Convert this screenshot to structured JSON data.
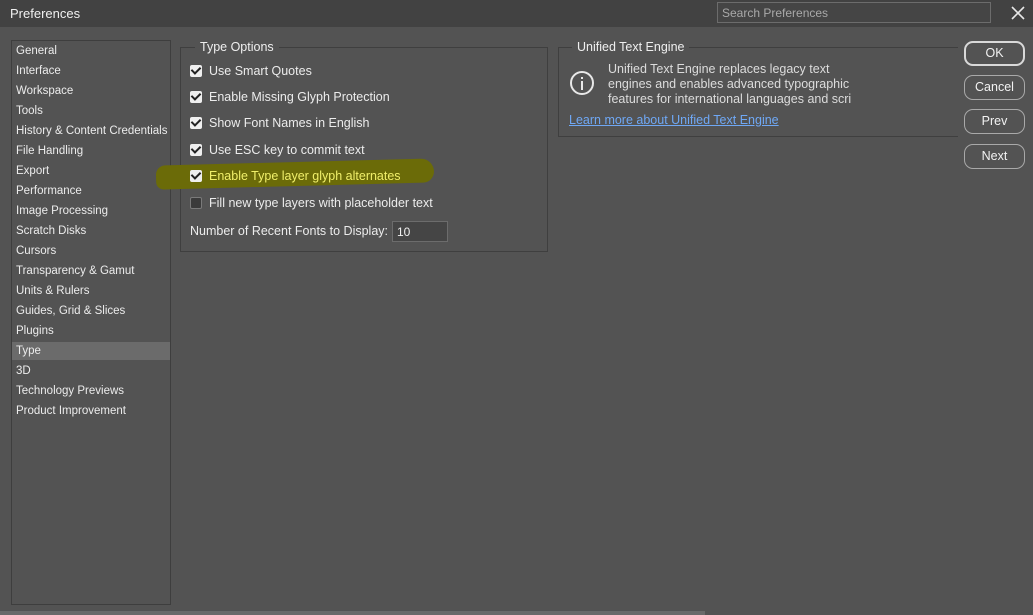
{
  "window": {
    "title": "Preferences",
    "search_placeholder": "Search Preferences"
  },
  "sidebar": {
    "items": [
      {
        "label": "General"
      },
      {
        "label": "Interface"
      },
      {
        "label": "Workspace"
      },
      {
        "label": "Tools"
      },
      {
        "label": "History & Content Credentials"
      },
      {
        "label": "File Handling"
      },
      {
        "label": "Export"
      },
      {
        "label": "Performance"
      },
      {
        "label": "Image Processing"
      },
      {
        "label": "Scratch Disks"
      },
      {
        "label": "Cursors"
      },
      {
        "label": "Transparency & Gamut"
      },
      {
        "label": "Units & Rulers"
      },
      {
        "label": "Guides, Grid & Slices"
      },
      {
        "label": "Plugins"
      },
      {
        "label": "Type"
      },
      {
        "label": "3D"
      },
      {
        "label": "Technology Previews"
      },
      {
        "label": "Product Improvement"
      }
    ],
    "selected": "Type"
  },
  "type_options": {
    "title": "Type Options",
    "options": [
      {
        "label": "Use Smart Quotes",
        "checked": true
      },
      {
        "label": "Enable Missing Glyph Protection",
        "checked": true
      },
      {
        "label": "Show Font Names in English",
        "checked": true
      },
      {
        "label": "Use ESC key to commit text",
        "checked": true
      },
      {
        "label": "Enable Type layer glyph alternates",
        "checked": true
      },
      {
        "label": "Fill new type layers with placeholder text",
        "checked": false
      }
    ],
    "recent_fonts_label": "Number of Recent Fonts to Display:",
    "recent_fonts_value": "10"
  },
  "unified_text_engine": {
    "title": "Unified Text Engine",
    "description_lines": [
      "Unified Text Engine replaces legacy text",
      "engines and enables advanced typographic",
      "features for international languages and scri"
    ],
    "link": "Learn more about Unified Text Engine"
  },
  "buttons": {
    "ok": "OK",
    "cancel": "Cancel",
    "prev": "Prev",
    "next": "Next"
  },
  "colors": {
    "background": "#535353",
    "highlight": "#6b6b08",
    "link": "#6fa8f5"
  }
}
